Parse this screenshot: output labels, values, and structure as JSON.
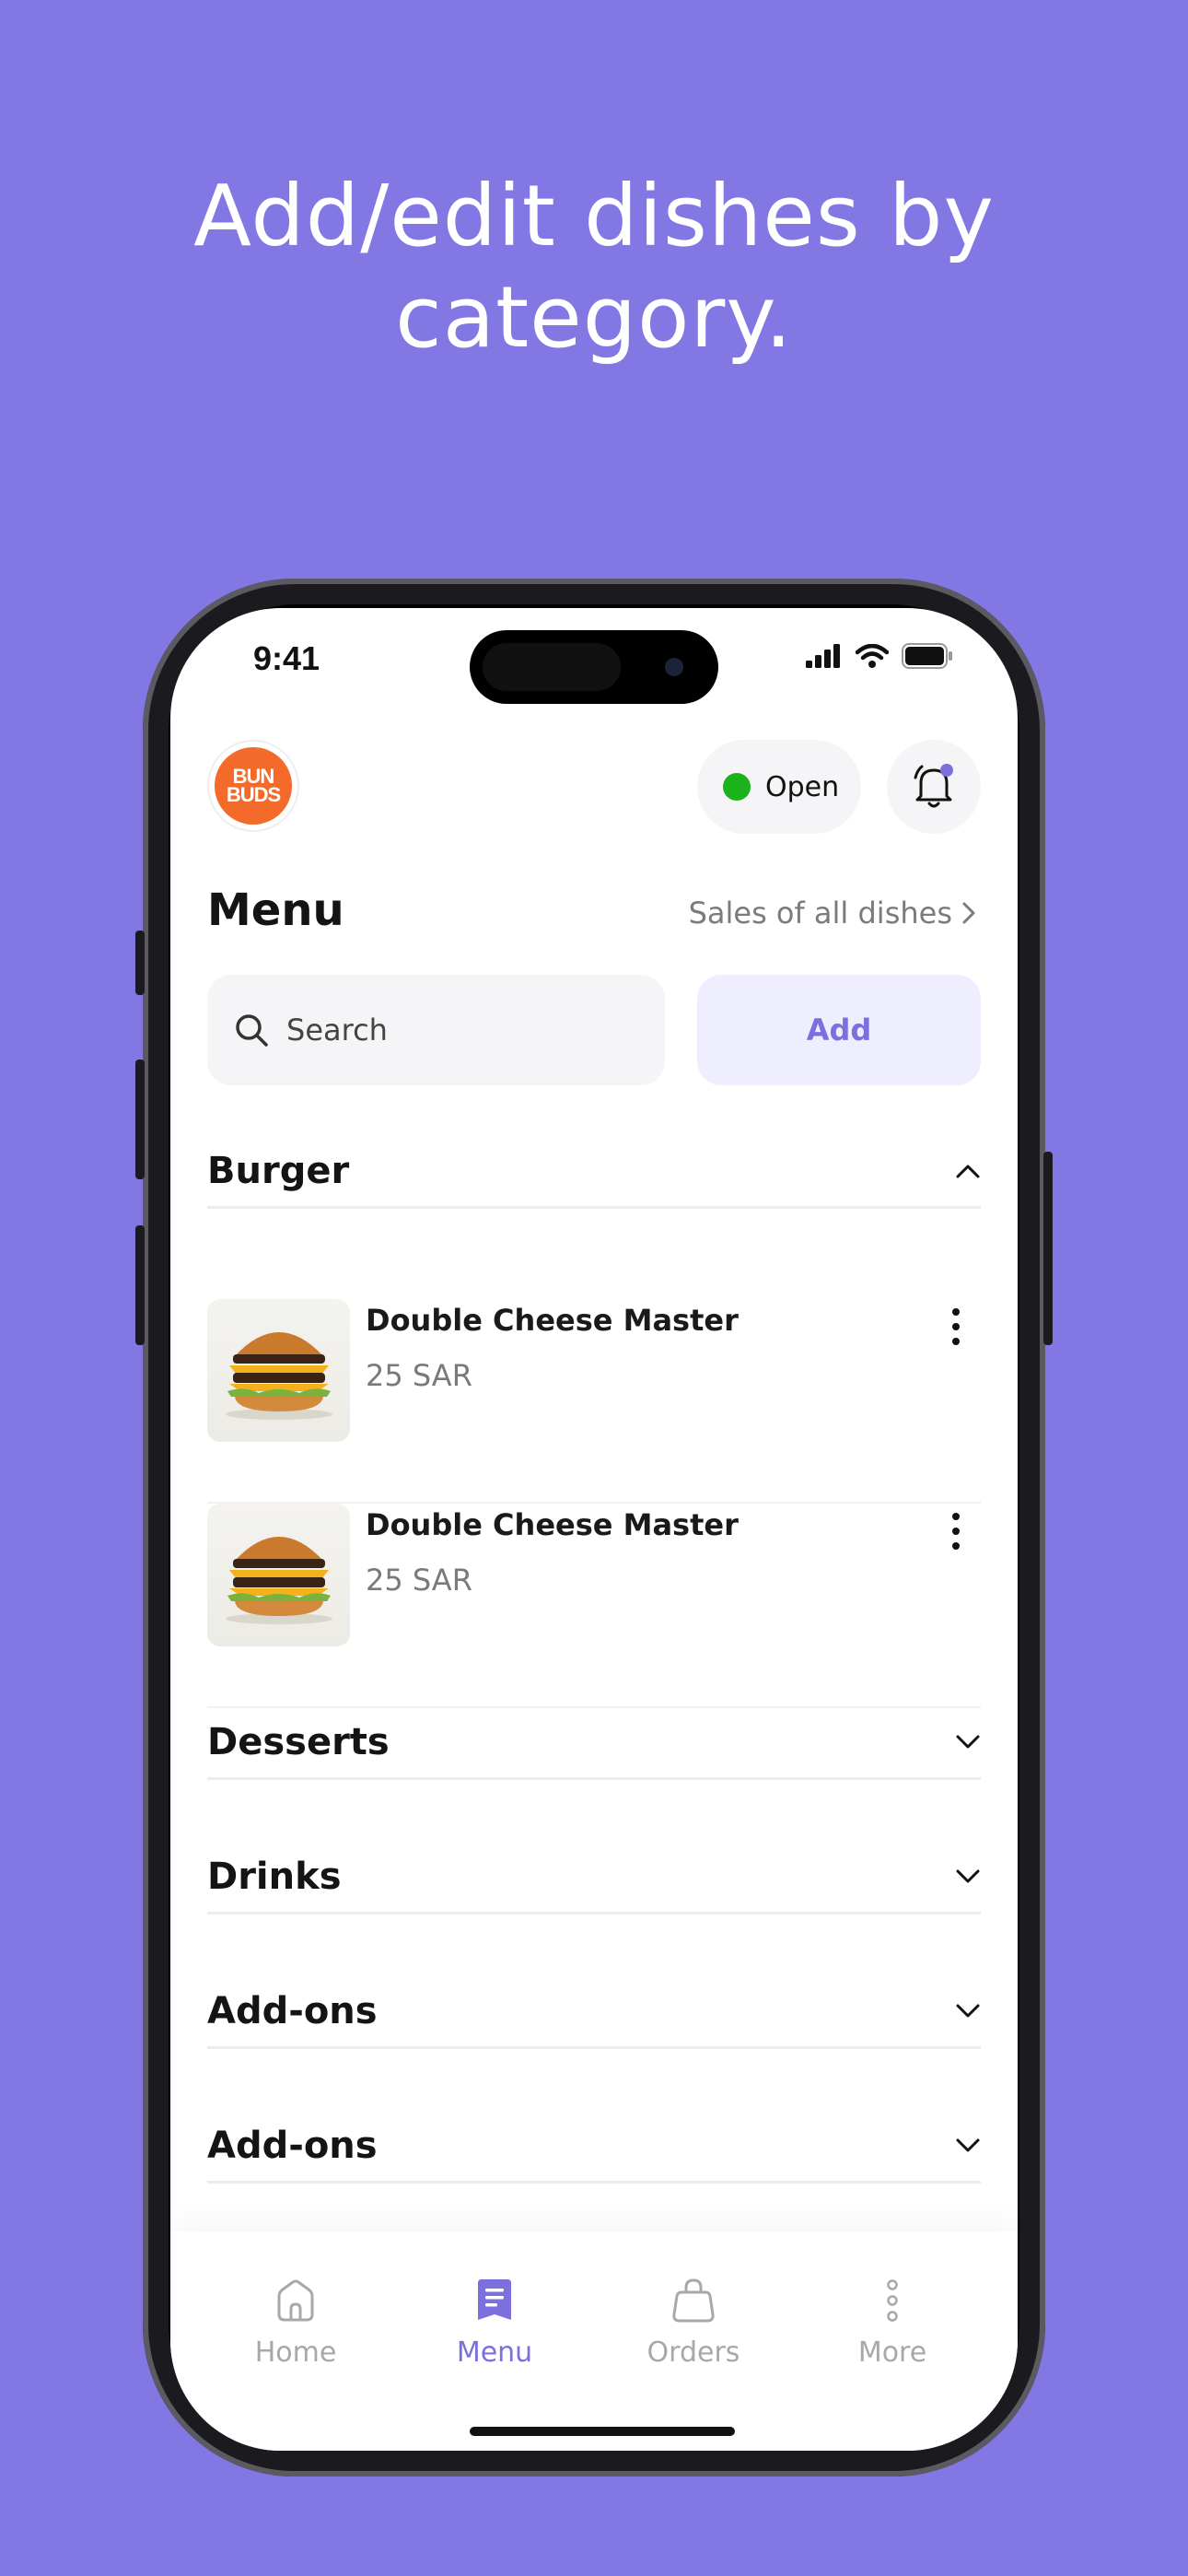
{
  "promo": {
    "headline": "Add/edit dishes by category."
  },
  "status_bar": {
    "time": "9:41"
  },
  "header": {
    "logo_text_top": "BUN",
    "logo_text_bottom": "BUDS",
    "status_label": "Open",
    "status_color": "#1bb21b"
  },
  "menu": {
    "title": "Menu",
    "sales_link": "Sales of all dishes",
    "search_placeholder": "Search",
    "add_label": "Add"
  },
  "categories": [
    {
      "name": "Burger",
      "expanded": true,
      "dishes": [
        {
          "name": "Double Cheese Master",
          "price": "25 SAR"
        },
        {
          "name": "Double Cheese Master",
          "price": "25 SAR"
        }
      ]
    },
    {
      "name": "Desserts",
      "expanded": false
    },
    {
      "name": "Drinks",
      "expanded": false
    },
    {
      "name": "Add-ons",
      "expanded": false
    },
    {
      "name": "Add-ons",
      "expanded": false
    }
  ],
  "tabbar": {
    "items": [
      {
        "label": "Home",
        "icon": "home-icon",
        "active": false
      },
      {
        "label": "Menu",
        "icon": "menu-doc-icon",
        "active": true
      },
      {
        "label": "Orders",
        "icon": "bag-icon",
        "active": false
      },
      {
        "label": "More",
        "icon": "more-vertical-icon",
        "active": false
      }
    ]
  },
  "colors": {
    "background": "#8277e3",
    "accent": "#7c6fde",
    "add_bg": "#efeefe"
  }
}
